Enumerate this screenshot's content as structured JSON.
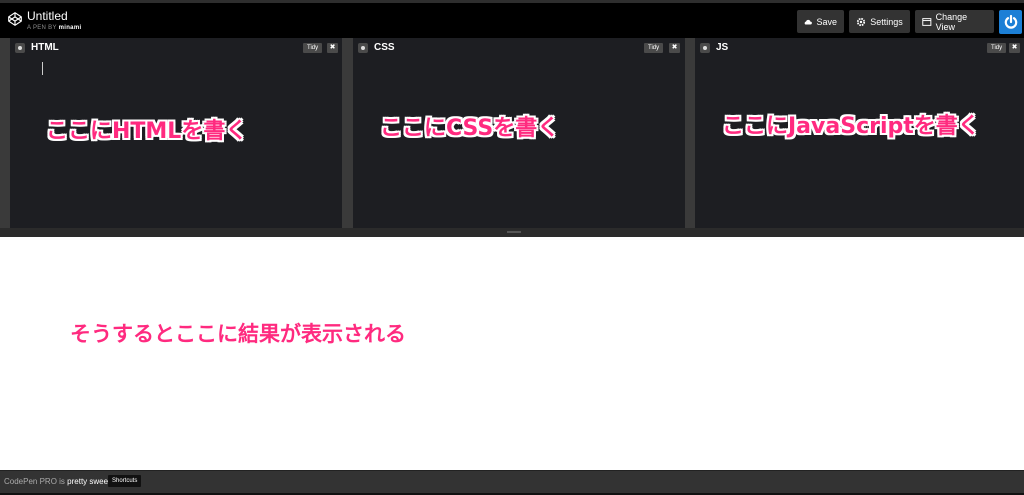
{
  "header": {
    "title": "Untitled",
    "pen_by_prefix": "A PEN BY",
    "author": "minami",
    "buttons": {
      "save": "Save",
      "settings": "Settings",
      "change_view": "Change View"
    },
    "accent_color": "#1c7fd6"
  },
  "editors": [
    {
      "title": "HTML",
      "tidy": "Tidy",
      "close": "✖"
    },
    {
      "title": "CSS",
      "tidy": "Tidy",
      "close": "✖"
    },
    {
      "title": "JS",
      "tidy": "Tidy",
      "close": "✖"
    }
  ],
  "annotations": {
    "html": "ここにHTMLを書く",
    "css": "ここにCSSを書く",
    "js": "ここにJavaScriptを書く",
    "result": "そうするとここに結果が表示される",
    "color": "#ff2a7f"
  },
  "footer": {
    "prefix": "CodePen PRO is",
    "highlight": "pretty sweet.",
    "shortcuts": "Shortcuts"
  }
}
